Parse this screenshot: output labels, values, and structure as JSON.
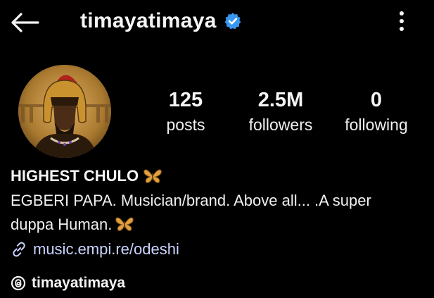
{
  "header": {
    "username": "timayatimaya",
    "verified": true,
    "back_icon": "arrow-left-icon",
    "menu_icon": "more-vertical-icon"
  },
  "profile": {
    "avatar": "avatar-illustration"
  },
  "stats": {
    "posts_count": "125",
    "posts_label": "posts",
    "followers_count": "2.5M",
    "followers_label": "followers",
    "following_count": "0",
    "following_label": "following"
  },
  "bio": {
    "name": "HIGHEST CHULO",
    "line1": "EGBERI PAPA. Musician/brand. Above all... .A super",
    "line2": "duppa Human.",
    "link": "music.empi.re/odeshi",
    "threads_handle": "timayatimaya"
  },
  "colors": {
    "background": "#000000",
    "text": "#f5f5f5",
    "link": "#c9d3ff",
    "verified": "#3897f0",
    "butterfly": "#e0a040"
  }
}
